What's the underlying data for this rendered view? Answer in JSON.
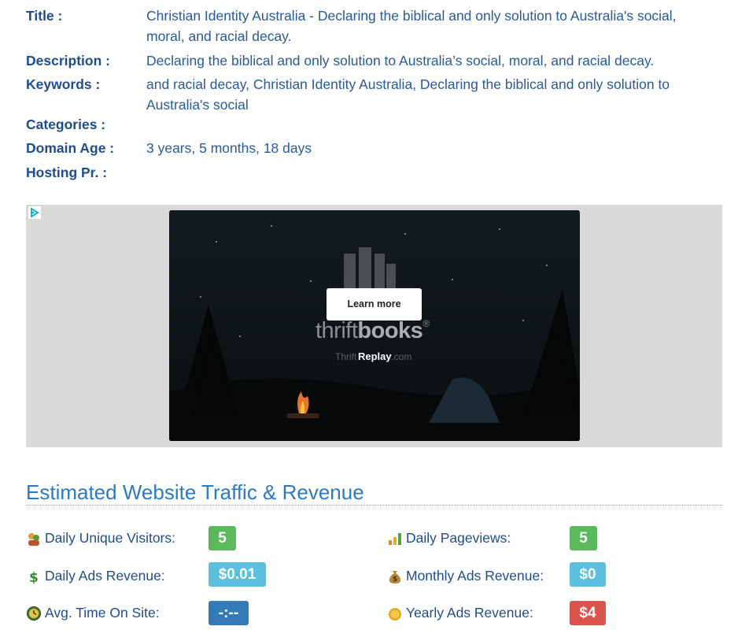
{
  "site_info": {
    "title_label": "Title :",
    "title_line1": "Christian Identity Australia - Declaring the biblical and only solution to Australia's social,",
    "title_line2": "moral, and racial decay.",
    "description_label": "Description :",
    "description_value": "Declaring the biblical and only solution to Australia’s social, moral, and racial decay.",
    "keywords_label": "Keywords :",
    "keywords_line1": "and racial decay, Christian Identity Australia, Declaring the biblical and only solution to",
    "keywords_line2": "Australia's social",
    "categories_label": "Categories :",
    "categories_value": "",
    "domain_age_label": "Domain Age :",
    "domain_age_value": "3 years, 5 months, 18 days",
    "hosting_label": "Hosting Pr. :",
    "hosting_value": ""
  },
  "ad": {
    "learn_more": "Learn more",
    "brand_thin": "thrift",
    "brand_bold": "books",
    "brand_mark": "®",
    "site_left": "Thrift",
    "site_right": ".com",
    "replay": "Replay"
  },
  "traffic": {
    "section_title": "Estimated Website Traffic & Revenue",
    "stats": [
      {
        "label": "Daily Unique Visitors:",
        "value": "5",
        "icon": "visitors-icon",
        "color": "#5cb85c"
      },
      {
        "label": "Daily Pageviews:",
        "value": "5",
        "icon": "pageviews-icon",
        "color": "#5cb85c"
      },
      {
        "label": "Daily Ads Revenue:",
        "value": "$0.01",
        "icon": "dollar-icon",
        "color": "#5bc0de"
      },
      {
        "label": "Monthly Ads Revenue:",
        "value": "$0",
        "icon": "money-bag-icon",
        "color": "#5bc0de"
      },
      {
        "label": "Avg. Time On Site:",
        "value": "-:--",
        "icon": "clock-icon",
        "color": "#337ab7"
      },
      {
        "label": "Yearly Ads Revenue:",
        "value": "$4",
        "icon": "coin-icon",
        "color": "#d9534f"
      }
    ]
  }
}
